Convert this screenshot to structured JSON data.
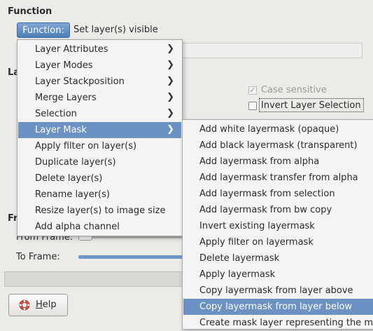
{
  "dialog": {
    "section_title": "Function",
    "function_button": "Function:",
    "function_value": "Set layer(s) visible",
    "clipped_label_1": "La",
    "clipped_label_2": "Fr",
    "case_sensitive": "Case sensitive",
    "invert_selection": "Invert Layer Selection",
    "from_frame": "From Frame:",
    "to_frame": "To Frame:",
    "help": "Help",
    "help_mnemonic": "H",
    "help_rest": "elp"
  },
  "main_menu": {
    "items": [
      {
        "label": "Layer Attributes",
        "submenu": true
      },
      {
        "label": "Layer Modes",
        "submenu": true
      },
      {
        "label": "Layer Stackposition",
        "submenu": true
      },
      {
        "label": "Merge Layers",
        "submenu": true
      },
      {
        "label": "Selection",
        "submenu": true
      },
      {
        "label": "Layer Mask",
        "submenu": true
      },
      {
        "label": "Apply filter on layer(s)"
      },
      {
        "label": "Duplicate layer(s)"
      },
      {
        "label": "Delete layer(s)"
      },
      {
        "label": "Rename layer(s)"
      },
      {
        "label": "Resize layer(s) to image size"
      },
      {
        "label": "Add alpha channel"
      }
    ]
  },
  "sub_menu": {
    "items": [
      {
        "label": "Add white layermask (opaque)"
      },
      {
        "label": "Add black layermask (transparent)"
      },
      {
        "label": "Add layermask from alpha"
      },
      {
        "label": "Add layermask transfer from alpha"
      },
      {
        "label": "Add layermask from selection"
      },
      {
        "label": "Add layermask from bw copy"
      },
      {
        "label": "Invert existing layermask"
      },
      {
        "label": "Apply filter on layermask"
      },
      {
        "label": "Delete layermask"
      },
      {
        "label": "Apply layermask"
      },
      {
        "label": "Copy layermask from layer above"
      },
      {
        "label": "Copy layermask from layer below"
      },
      {
        "label": "Create mask layer representing the m"
      }
    ]
  },
  "icons": {
    "submenu_arrow": "chevron-right-icon",
    "help": "lifebuoy-icon",
    "check": "check-icon"
  },
  "colors": {
    "highlight": "#6b92c3",
    "button_blue": "#4f7fb8"
  }
}
